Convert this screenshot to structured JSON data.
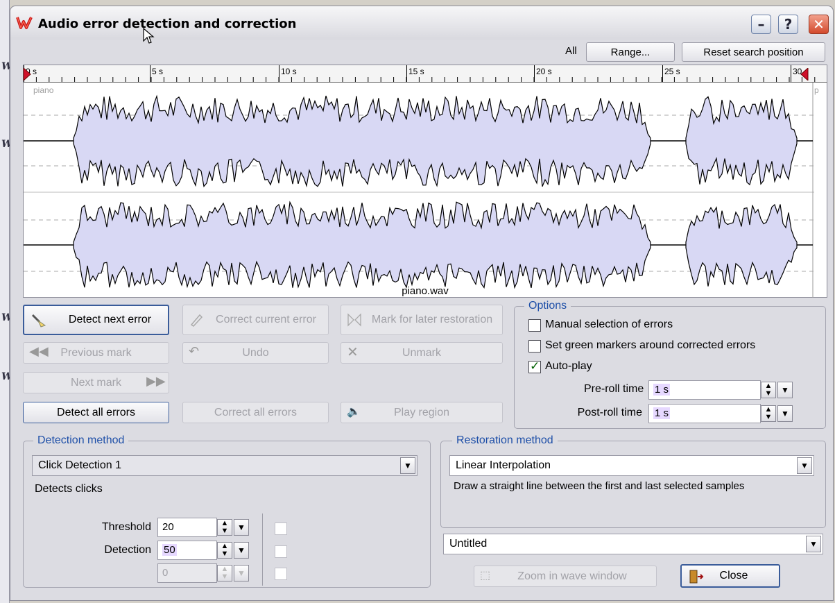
{
  "window": {
    "title": "Audio error detection and correction"
  },
  "titlebar_buttons": {
    "minimize": "–",
    "help": "?",
    "close": "✕"
  },
  "top_controls": {
    "all_label": "All",
    "range_button": "Range...",
    "reset_button": "Reset search position"
  },
  "ruler": {
    "ticks": [
      "0 s",
      "5 s",
      "10 s",
      "15 s",
      "20 s",
      "25 s",
      "30"
    ]
  },
  "wave": {
    "track_label": "piano",
    "right_label": "p",
    "file_name": "piano.wav"
  },
  "buttons": {
    "detect_next": "Detect next error",
    "correct_current": "Correct current error",
    "mark_later": "Mark for later restoration",
    "previous_mark": "Previous mark",
    "undo": "Undo",
    "unmark": "Unmark",
    "next_mark": "Next mark",
    "detect_all": "Detect all errors",
    "correct_all": "Correct all errors",
    "play_region": "Play region",
    "zoom": "Zoom in wave window",
    "close": "Close"
  },
  "options": {
    "title": "Options",
    "manual_selection": {
      "label": "Manual selection of errors",
      "checked": false
    },
    "green_markers": {
      "label": "Set green markers around corrected errors",
      "checked": false
    },
    "auto_play": {
      "label": "Auto-play",
      "checked": true
    },
    "preroll": {
      "label": "Pre-roll time",
      "value": "1 s"
    },
    "postroll": {
      "label": "Post-roll time",
      "value": "1 s"
    }
  },
  "detection": {
    "title": "Detection method",
    "selected": "Click Detection 1",
    "description": "Detects clicks",
    "threshold": {
      "label": "Threshold",
      "value": "20"
    },
    "detection": {
      "label": "Detection",
      "value": "50"
    },
    "third": {
      "value": "0"
    }
  },
  "restoration": {
    "title": "Restoration method",
    "selected": "Linear Interpolation",
    "description": "Draw a straight line between the first and last selected samples"
  },
  "preset": {
    "selected": "Untitled"
  },
  "colors": {
    "accent": "#1e4fa8",
    "wave_fill": "#d8d8f4",
    "close_red": "#d3492c"
  }
}
